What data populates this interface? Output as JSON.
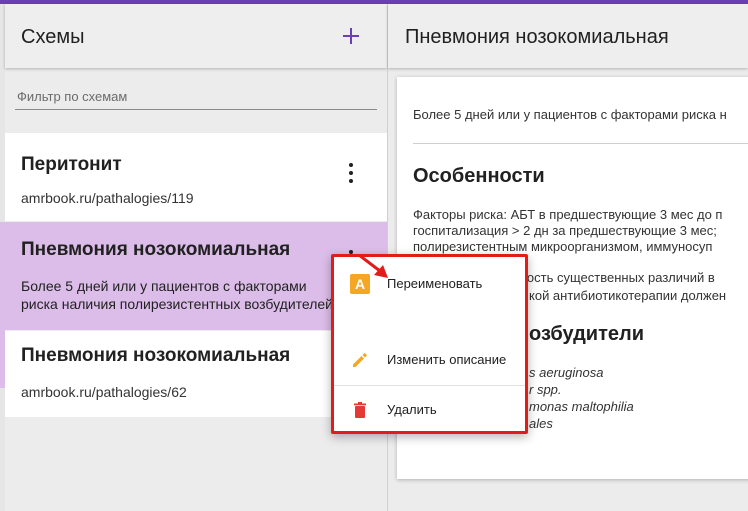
{
  "colors": {
    "accent": "#6a3fb5",
    "selected": "#dcbde9",
    "highlight": "#e31b1b",
    "rename_icon": "#f5a623",
    "delete_icon": "#e53935"
  },
  "schemes_panel": {
    "title": "Схемы",
    "add_icon": "plus-icon",
    "filter_placeholder": "Фильтр по схемам",
    "items": [
      {
        "title": "Перитонит",
        "subtitle": "amrbook.ru/pathalogies/119",
        "selected": false
      },
      {
        "title": "Пневмония нозокомиальная",
        "description": "Более 5 дней или у пациентов с факторами риска наличия полирезистентных возбудителей",
        "selected": true
      },
      {
        "title": "Пневмония нозокомиальная",
        "subtitle": "amrbook.ru/pathalogies/62",
        "selected": false
      }
    ]
  },
  "detail_panel": {
    "title": "Пневмония нозокомиальная",
    "intro": "Более 5 дней или у пациентов с факторами риска н",
    "features_heading": "Особенности",
    "features_lines": [
      "Факторы риска: АБТ в предшествующие 3 мес до п",
      "госпитализация > 2 дн за предшествующие 3 мес;",
      "полирезистентным микроорганизмом, иммуносуп"
    ],
    "note_lines": [
      "Учитывая возможность существенных различий в",
      "кой антибиотикотерапии должен"
    ],
    "pathogens_heading_partial": "озбудители",
    "pathogens": [
      "s aeruginosa",
      "r spp.",
      "monas maltophilia",
      "ales"
    ]
  },
  "context_menu": {
    "items": [
      {
        "label": "Переименовать",
        "icon": "rename-icon"
      },
      {
        "label": "Изменить описание",
        "icon": "pencil-icon"
      },
      {
        "label": "Удалить",
        "icon": "trash-icon"
      }
    ]
  }
}
